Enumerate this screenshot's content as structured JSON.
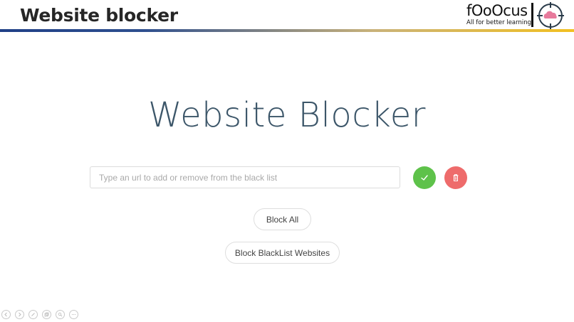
{
  "slide": {
    "title": "Website blocker",
    "logo": {
      "word": "fOoOcus",
      "tagline": "All for better learning"
    }
  },
  "app": {
    "heading": "Website Blocker",
    "url_input": {
      "placeholder": "Type an url to add or remove from the black list",
      "value": ""
    },
    "add_button_icon": "check-icon",
    "remove_button_icon": "trash-icon",
    "block_all_label": "Block All",
    "block_blacklist_label": "Block BlackList Websites"
  },
  "colors": {
    "heading": "#3c5669",
    "add": "#5ec24a",
    "remove": "#ee6b6b",
    "header_rule_start": "#1f3f86",
    "header_rule_end": "#f2c021"
  },
  "toolbar": {
    "icons": [
      "prev-icon",
      "next-icon",
      "pen-icon",
      "copy-icon",
      "zoom-icon",
      "more-icon"
    ]
  }
}
